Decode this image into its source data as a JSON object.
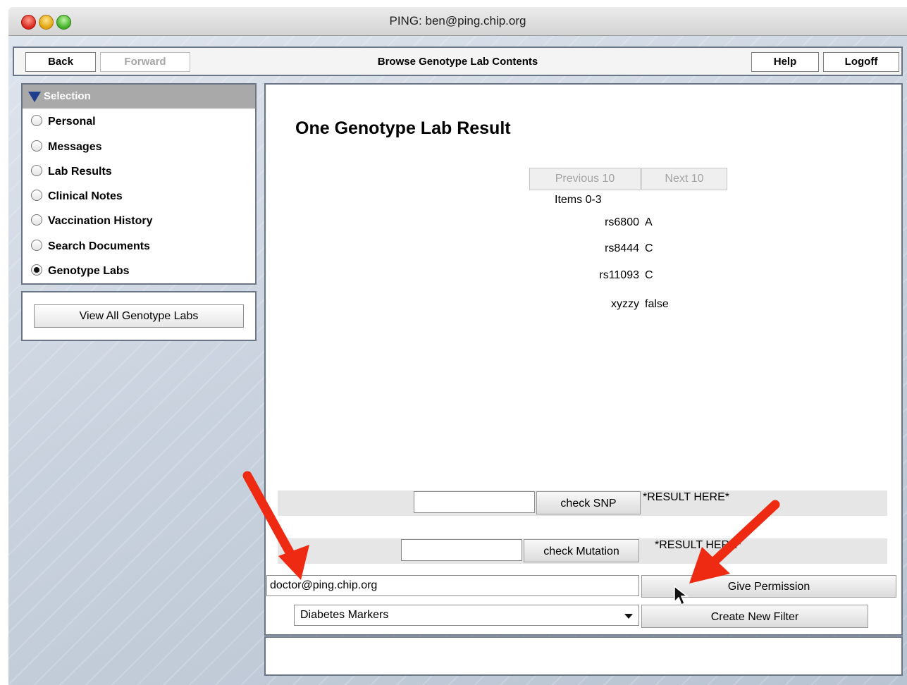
{
  "window": {
    "title": "PING: ben@ping.chip.org"
  },
  "toolbar": {
    "back_label": "Back",
    "forward_label": "Forward",
    "title": "Browse Genotype Lab Contents",
    "help_label": "Help",
    "logoff_label": "Logoff"
  },
  "sidebar": {
    "header": "Selection",
    "items": [
      {
        "label": "Personal",
        "checked": false
      },
      {
        "label": "Messages",
        "checked": false
      },
      {
        "label": "Lab Results",
        "checked": false
      },
      {
        "label": "Clinical Notes",
        "checked": false
      },
      {
        "label": "Vaccination History",
        "checked": false
      },
      {
        "label": "Search Documents",
        "checked": false
      },
      {
        "label": "Genotype Labs",
        "checked": true
      }
    ],
    "view_all_label": "View All Genotype Labs"
  },
  "main": {
    "title": "One Genotype Lab Result",
    "prev_label": "Previous 10",
    "next_label": "Next 10",
    "items_label": "Items 0-3",
    "rows": [
      {
        "key": "rs6800",
        "value": "A"
      },
      {
        "key": "rs8444",
        "value": "C"
      },
      {
        "key": "rs11093",
        "value": "C"
      },
      {
        "key": "xyzzy",
        "value": "false"
      }
    ],
    "snp": {
      "value": "",
      "button_label": "check SNP",
      "result": "*RESULT HERE*"
    },
    "mutation": {
      "value": "",
      "button_label": "check Mutation",
      "result": "*RESULT HERE*"
    },
    "permission": {
      "email": "doctor@ping.chip.org",
      "button_label": "Give Permission"
    },
    "filter": {
      "selected": "Diabetes Markers",
      "button_label": "Create New Filter"
    }
  },
  "colors": {
    "annotation_arrow": "#ee2a12",
    "panel_border": "#6a7686"
  },
  "icons": [
    "close-icon",
    "minimize-icon",
    "zoom-icon",
    "collapse-triangle-icon",
    "dropdown-arrow-icon",
    "mouse-cursor-icon",
    "annotation-arrow-icon"
  ]
}
